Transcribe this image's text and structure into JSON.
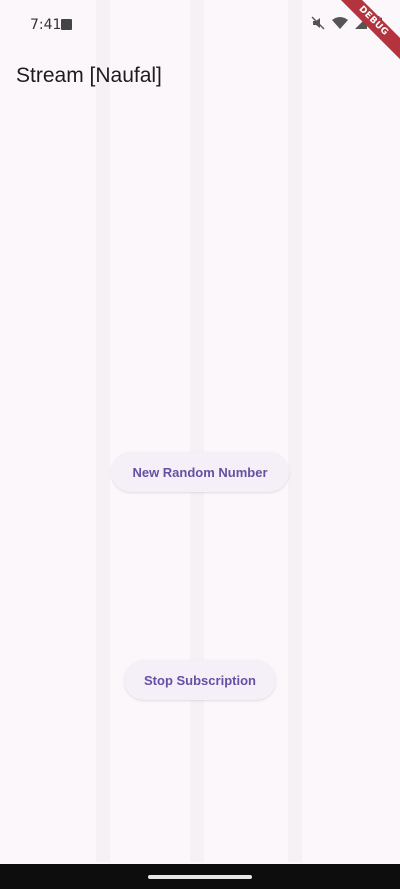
{
  "status_bar": {
    "time": "7:41",
    "icons": [
      "app-notification-icon",
      "mute-icon",
      "wifi-icon",
      "signal-icon",
      "battery-icon"
    ]
  },
  "debug_banner": {
    "label": "DEBUG"
  },
  "app_bar": {
    "title": "Stream [Naufal]"
  },
  "actions": {
    "new_random_number_label": "New Random Number",
    "stop_subscription_label": "Stop Subscription"
  },
  "colors": {
    "background": "#fcf7fb",
    "button_background": "#f5eff7",
    "button_text": "#6750a4",
    "debug_ribbon": "#b3343e",
    "nav_bar": "#0e0d0e"
  }
}
